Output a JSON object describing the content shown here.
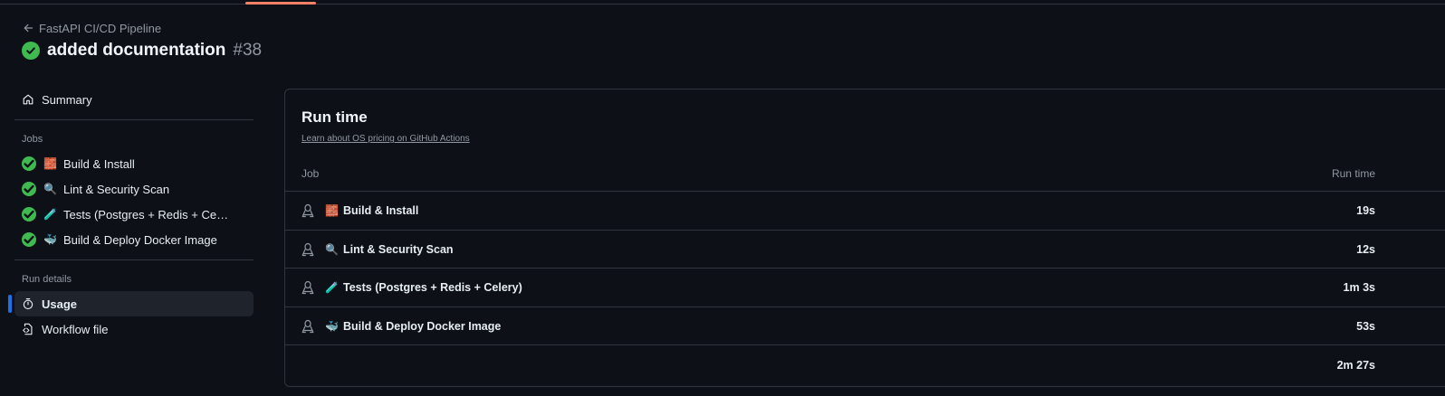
{
  "header": {
    "breadcrumb": "FastAPI CI/CD Pipeline",
    "title": "added documentation",
    "run_number": "#38"
  },
  "sidebar": {
    "summary_label": "Summary",
    "jobs_heading": "Jobs",
    "jobs": [
      {
        "emoji": "🧱",
        "label": "Build & Install"
      },
      {
        "emoji": "🔍",
        "label": "Lint & Security Scan"
      },
      {
        "emoji": "🧪",
        "label": "Tests (Postgres + Redis + Cele..."
      },
      {
        "emoji": "🐳",
        "label": "Build & Deploy Docker Image"
      }
    ],
    "run_details_heading": "Run details",
    "usage_label": "Usage",
    "workflow_file_label": "Workflow file"
  },
  "panel": {
    "title": "Run time",
    "link": "Learn about OS pricing on GitHub Actions",
    "col_job": "Job",
    "col_runtime": "Run time",
    "rows": [
      {
        "emoji": "🧱",
        "name": "Build & Install",
        "time": "19s"
      },
      {
        "emoji": "🔍",
        "name": "Lint & Security Scan",
        "time": "12s"
      },
      {
        "emoji": "🧪",
        "name": "Tests (Postgres + Redis + Celery)",
        "time": "1m 3s"
      },
      {
        "emoji": "🐳",
        "name": "Build & Deploy Docker Image",
        "time": "53s"
      }
    ],
    "total": "2m 27s"
  },
  "colors": {
    "success": "#3fb950",
    "accent": "#1f6feb",
    "tab_underline": "#f78166"
  }
}
